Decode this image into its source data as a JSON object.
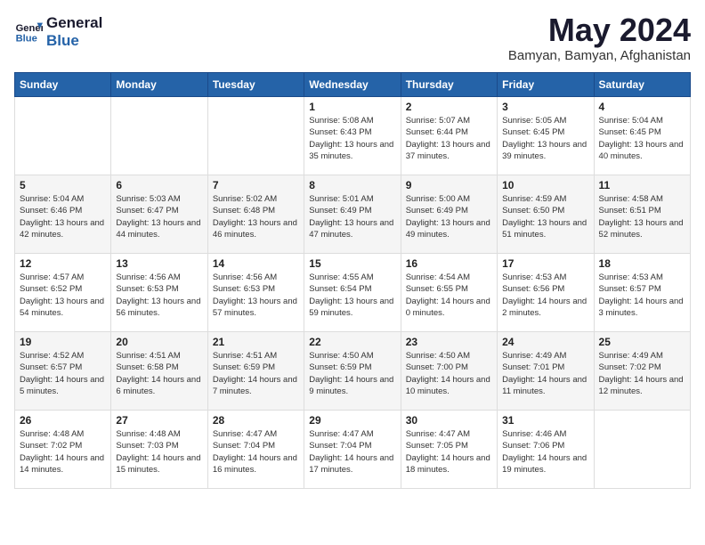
{
  "header": {
    "logo_line1": "General",
    "logo_line2": "Blue",
    "month_year": "May 2024",
    "location": "Bamyan, Bamyan, Afghanistan"
  },
  "weekdays": [
    "Sunday",
    "Monday",
    "Tuesday",
    "Wednesday",
    "Thursday",
    "Friday",
    "Saturday"
  ],
  "weeks": [
    [
      null,
      null,
      null,
      {
        "day": 1,
        "sunrise": "5:08 AM",
        "sunset": "6:43 PM",
        "daylight": "13 hours and 35 minutes."
      },
      {
        "day": 2,
        "sunrise": "5:07 AM",
        "sunset": "6:44 PM",
        "daylight": "13 hours and 37 minutes."
      },
      {
        "day": 3,
        "sunrise": "5:05 AM",
        "sunset": "6:45 PM",
        "daylight": "13 hours and 39 minutes."
      },
      {
        "day": 4,
        "sunrise": "5:04 AM",
        "sunset": "6:45 PM",
        "daylight": "13 hours and 40 minutes."
      }
    ],
    [
      {
        "day": 5,
        "sunrise": "5:04 AM",
        "sunset": "6:46 PM",
        "daylight": "13 hours and 42 minutes."
      },
      {
        "day": 6,
        "sunrise": "5:03 AM",
        "sunset": "6:47 PM",
        "daylight": "13 hours and 44 minutes."
      },
      {
        "day": 7,
        "sunrise": "5:02 AM",
        "sunset": "6:48 PM",
        "daylight": "13 hours and 46 minutes."
      },
      {
        "day": 8,
        "sunrise": "5:01 AM",
        "sunset": "6:49 PM",
        "daylight": "13 hours and 47 minutes."
      },
      {
        "day": 9,
        "sunrise": "5:00 AM",
        "sunset": "6:49 PM",
        "daylight": "13 hours and 49 minutes."
      },
      {
        "day": 10,
        "sunrise": "4:59 AM",
        "sunset": "6:50 PM",
        "daylight": "13 hours and 51 minutes."
      },
      {
        "day": 11,
        "sunrise": "4:58 AM",
        "sunset": "6:51 PM",
        "daylight": "13 hours and 52 minutes."
      }
    ],
    [
      {
        "day": 12,
        "sunrise": "4:57 AM",
        "sunset": "6:52 PM",
        "daylight": "13 hours and 54 minutes."
      },
      {
        "day": 13,
        "sunrise": "4:56 AM",
        "sunset": "6:53 PM",
        "daylight": "13 hours and 56 minutes."
      },
      {
        "day": 14,
        "sunrise": "4:56 AM",
        "sunset": "6:53 PM",
        "daylight": "13 hours and 57 minutes."
      },
      {
        "day": 15,
        "sunrise": "4:55 AM",
        "sunset": "6:54 PM",
        "daylight": "13 hours and 59 minutes."
      },
      {
        "day": 16,
        "sunrise": "4:54 AM",
        "sunset": "6:55 PM",
        "daylight": "14 hours and 0 minutes."
      },
      {
        "day": 17,
        "sunrise": "4:53 AM",
        "sunset": "6:56 PM",
        "daylight": "14 hours and 2 minutes."
      },
      {
        "day": 18,
        "sunrise": "4:53 AM",
        "sunset": "6:57 PM",
        "daylight": "14 hours and 3 minutes."
      }
    ],
    [
      {
        "day": 19,
        "sunrise": "4:52 AM",
        "sunset": "6:57 PM",
        "daylight": "14 hours and 5 minutes."
      },
      {
        "day": 20,
        "sunrise": "4:51 AM",
        "sunset": "6:58 PM",
        "daylight": "14 hours and 6 minutes."
      },
      {
        "day": 21,
        "sunrise": "4:51 AM",
        "sunset": "6:59 PM",
        "daylight": "14 hours and 7 minutes."
      },
      {
        "day": 22,
        "sunrise": "4:50 AM",
        "sunset": "6:59 PM",
        "daylight": "14 hours and 9 minutes."
      },
      {
        "day": 23,
        "sunrise": "4:50 AM",
        "sunset": "7:00 PM",
        "daylight": "14 hours and 10 minutes."
      },
      {
        "day": 24,
        "sunrise": "4:49 AM",
        "sunset": "7:01 PM",
        "daylight": "14 hours and 11 minutes."
      },
      {
        "day": 25,
        "sunrise": "4:49 AM",
        "sunset": "7:02 PM",
        "daylight": "14 hours and 12 minutes."
      }
    ],
    [
      {
        "day": 26,
        "sunrise": "4:48 AM",
        "sunset": "7:02 PM",
        "daylight": "14 hours and 14 minutes."
      },
      {
        "day": 27,
        "sunrise": "4:48 AM",
        "sunset": "7:03 PM",
        "daylight": "14 hours and 15 minutes."
      },
      {
        "day": 28,
        "sunrise": "4:47 AM",
        "sunset": "7:04 PM",
        "daylight": "14 hours and 16 minutes."
      },
      {
        "day": 29,
        "sunrise": "4:47 AM",
        "sunset": "7:04 PM",
        "daylight": "14 hours and 17 minutes."
      },
      {
        "day": 30,
        "sunrise": "4:47 AM",
        "sunset": "7:05 PM",
        "daylight": "14 hours and 18 minutes."
      },
      {
        "day": 31,
        "sunrise": "4:46 AM",
        "sunset": "7:06 PM",
        "daylight": "14 hours and 19 minutes."
      },
      null
    ]
  ]
}
